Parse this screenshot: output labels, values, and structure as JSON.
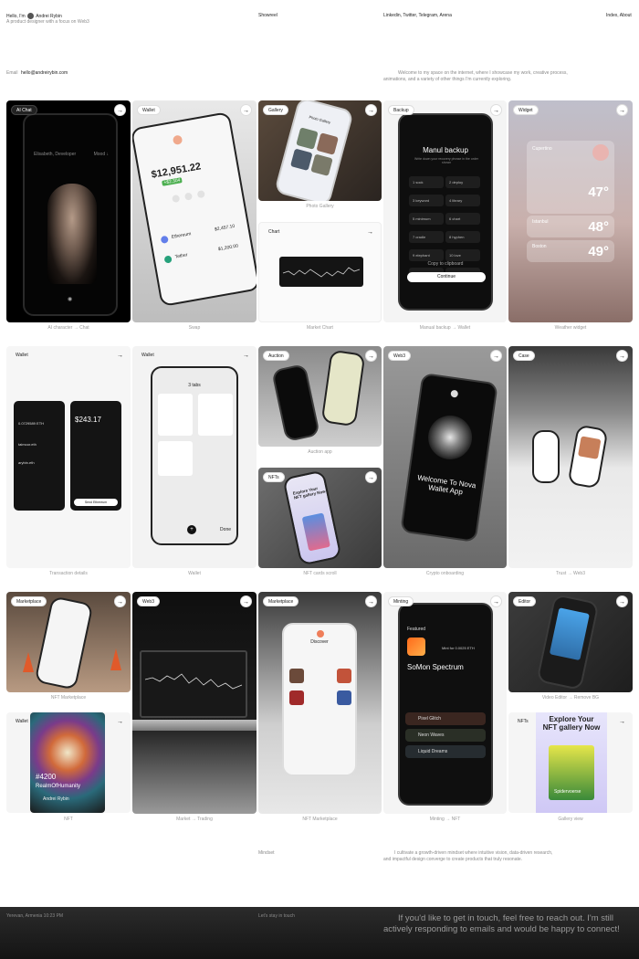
{
  "header": {
    "intro_prefix": "Hello, I'm",
    "name": "Andrei Rybin",
    "tagline": "A product designer with a focus on Web3",
    "nav_showreel": "Showreel",
    "nav_social": "Linkedin, Twitter, Telegram, Arena",
    "nav_right": "Index, About",
    "email_label": "Email",
    "email": "hello@andreirybin.com",
    "welcome": "Welcome to my space on the internet, where I showcase my work, creative process, animations, and a variety of other things I'm currently exploring."
  },
  "cards": {
    "ai_chat": {
      "badge": "AI Chat",
      "caption": "AI character → Chat",
      "user": "Elisabeth, Developer",
      "tag": "Mood ↓"
    },
    "wallet_swap": {
      "badge": "Wallet",
      "caption": "Swap",
      "amount": "$12,951.22",
      "change": "+$2,304",
      "r1": "Ethereum",
      "r1v": "$2,457.10",
      "r2": "Tether",
      "r2v": "$1,200.00"
    },
    "gallery": {
      "badge": "Gallery",
      "caption": "Photo Gallery",
      "screen_title": "Photo Gallery"
    },
    "chart": {
      "badge": "Chart",
      "caption": "Market Chart"
    },
    "backup": {
      "badge": "Backup",
      "caption": "Manual backup → Wallet",
      "title": "Manul backup",
      "sub": "Write down your recovery phrase in the order shown",
      "words": [
        "1 sock",
        "2 deploy",
        "3 keyword",
        "4 library",
        "5 minimum",
        "6 chart",
        "7 cradle",
        "8 hyphen",
        "9 elephant",
        "10 love",
        "11 galaxy",
        "12 tide"
      ],
      "copy": "Copy to clipboard",
      "cta": "Continue"
    },
    "widget": {
      "badge": "Widget",
      "caption": "Weather widget",
      "city1": "Cupertino",
      "t1": "47°",
      "city2": "Istanbul",
      "t2": "48°",
      "city3": "Boston",
      "t3": "49°"
    },
    "tx": {
      "badge": "Wallet",
      "caption": "Transaction details",
      "amount": "$243.17",
      "eth": "0.0729589 ETH",
      "ens1": "taimoor.eth",
      "ens2": "arybin.eth",
      "cta": "Send Ethereum"
    },
    "wallet_tabs": {
      "badge": "Wallet",
      "caption": "Wallet",
      "tabs": "3 tabs",
      "done": "Done"
    },
    "auction": {
      "badge": "Auction",
      "caption": "Auction app"
    },
    "web3_onb": {
      "badge": "Web3",
      "caption": "Crypto onboarding",
      "title": "Welcome To Nova Wallet App"
    },
    "case": {
      "badge": "Case",
      "caption": "Trust → Web3"
    },
    "nfts_scroll": {
      "badge": "NFTs",
      "caption": "NFT cards scroll",
      "title": "Explore Your NFT gallery Now"
    },
    "marketplace1": {
      "badge": "Marketplace",
      "caption": "NFT Marketplace"
    },
    "web3_trading": {
      "badge": "Web3",
      "caption": "Market → Trading"
    },
    "marketplace2": {
      "badge": "Marketplace",
      "caption": "NFT Marketplace",
      "screen_title": "Discover"
    },
    "minting": {
      "badge": "Minting",
      "caption": "Minting → NFT",
      "featured": "Featured",
      "price": "Mint for 0.0025 ETH",
      "title": "SoMon Spectrum",
      "r1": "Pixel Glitch",
      "r2": "Neon Waves",
      "r3": "Liquid Dreams"
    },
    "editor": {
      "badge": "Editor",
      "caption": "Video Editor → Remove BG"
    },
    "wallet_nft": {
      "badge": "Wallet",
      "caption": "NFT",
      "id": "#4200",
      "name": "RealmOfHumanity",
      "owner": "Andrei Rybin"
    },
    "nfts_gallery": {
      "badge": "NFTs",
      "caption": "Gallery view",
      "title": "Explore Your NFT gallery Now",
      "item": "Spidervoerse"
    }
  },
  "bottom": {
    "mindset": "Mindset",
    "mindset_text": "I cultivate a growth-driven mindset where intuitive vision, data-driven research, and impactful design converge to create products that truly resonate."
  },
  "footer": {
    "location": "Yerevan, Armenia 10:23 PM",
    "cta_small": "Let's stay in touch",
    "cta_big": "If you'd like to get in touch, feel free to reach out. I'm still actively responding to emails and would be happy to connect!"
  },
  "colors": {
    "accent": "#ffffff",
    "footer_bg": "#1c1c1c"
  }
}
